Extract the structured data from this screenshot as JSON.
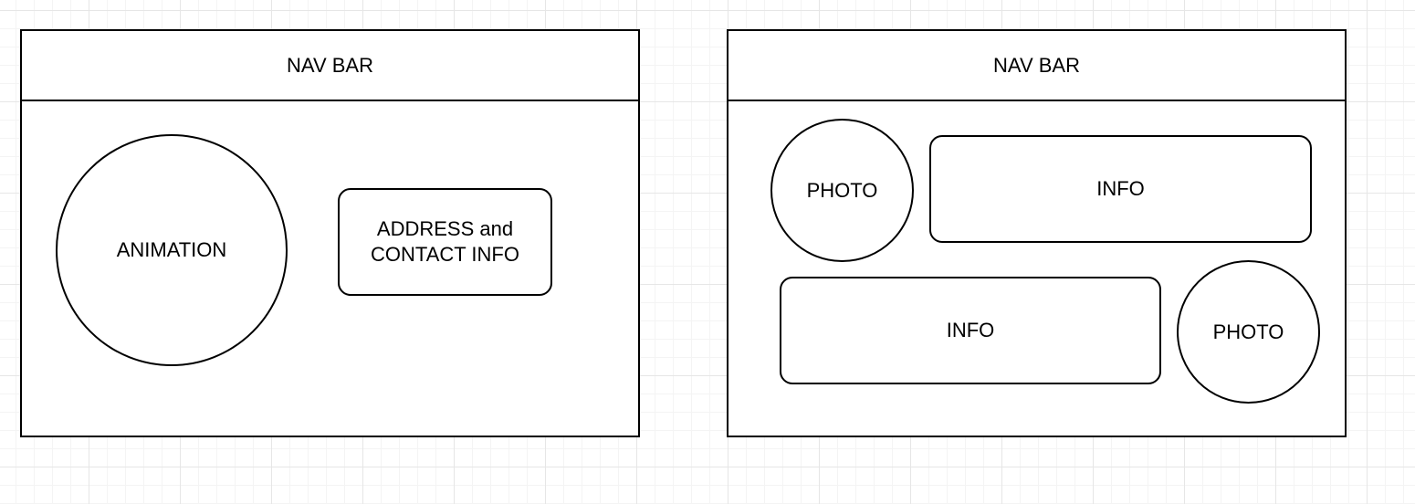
{
  "left_mockup": {
    "navbar_label": "NAV BAR",
    "animation_label": "ANIMATION",
    "contact_box": {
      "line1": "ADDRESS and",
      "line2": "CONTACT INFO"
    }
  },
  "right_mockup": {
    "navbar_label": "NAV BAR",
    "row1": {
      "photo_label": "PHOTO",
      "info_label": "INFO"
    },
    "row2": {
      "info_label": "INFO",
      "photo_label": "PHOTO"
    }
  },
  "colors": {
    "stroke": "#000000",
    "fill": "#ffffff",
    "grid": "#e6e6e6"
  }
}
